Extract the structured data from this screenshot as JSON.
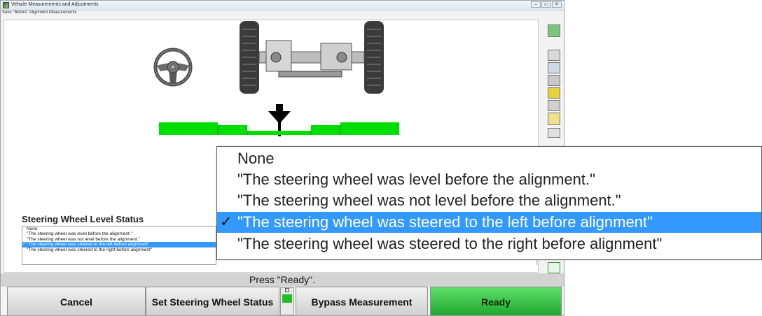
{
  "window": {
    "title": "Vehicle Measurements and Adjustments",
    "subtitle": "Save \"Before\" Alignment Measurements",
    "controls": [
      "–",
      "▭",
      "✕"
    ]
  },
  "steering_status": {
    "title": "Steering Wheel Level Status",
    "options": [
      "None",
      "\"The steering wheel was level before the alignment.\"",
      "\"The steering wheel was not level before the alignment.\"",
      "\"The steering wheel was steered to the left before alignment\"",
      "\"The steering wheel was steered to the right before alignment\""
    ],
    "selected_index": 3,
    "check_mark": "✓"
  },
  "status_text": "Press \"Ready\".",
  "buttons": {
    "cancel": "Cancel",
    "set_steering": "Set Steering Wheel Status",
    "bypass": "Bypass Measurement",
    "ready": "Ready"
  },
  "colors": {
    "level_bar": "#00dd00",
    "selection": "#3399ff",
    "ready_button": "#2fbf3a"
  },
  "toolbar_icons": [
    "help-icon",
    "measure-icon",
    "adjust-icon",
    "camber-icon",
    "tools-icon",
    "sensor-icon",
    "caster-icon",
    "rotate-icon",
    "ride-height-icon"
  ]
}
